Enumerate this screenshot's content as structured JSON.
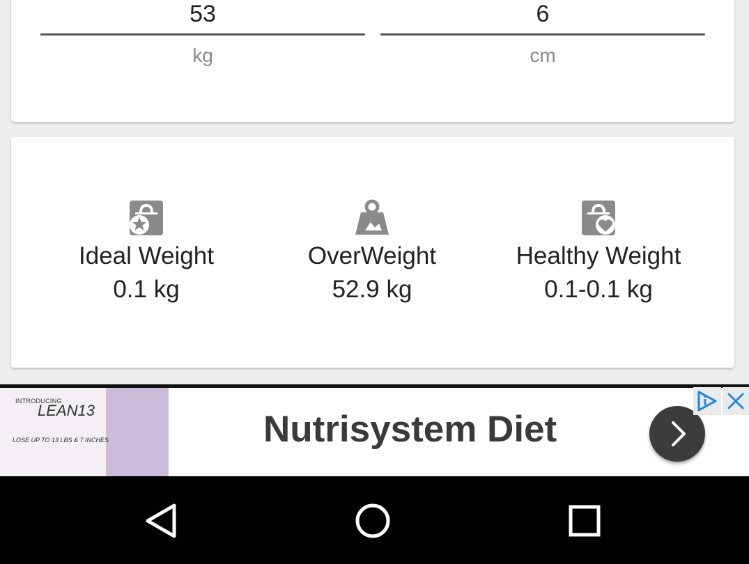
{
  "inputs": {
    "weight": {
      "value": "53",
      "unit": "kg"
    },
    "height": {
      "value": "6",
      "unit": "cm"
    }
  },
  "results": {
    "ideal": {
      "label": "Ideal Weight",
      "value": "0.1 kg",
      "icon": "scale-star-icon"
    },
    "over": {
      "label": "OverWeight",
      "value": "52.9 kg",
      "icon": "weight-icon"
    },
    "healthy": {
      "label": "Healthy Weight",
      "value": "0.1-0.1 kg",
      "icon": "scale-heart-icon"
    }
  },
  "ad": {
    "title": "Nutrisystem Diet",
    "image_intro": "INTRODUCING",
    "image_brand": "LEAN13",
    "image_tagline": "LOSE UP TO 13 LBS & 7 INCHES",
    "cta_icon": "chevron-right-icon",
    "adchoices_icon": "adchoices-icon",
    "close_icon": "close-icon"
  },
  "nav": {
    "back_icon": "back-triangle-icon",
    "home_icon": "home-circle-icon",
    "recents_icon": "recents-square-icon"
  },
  "colors": {
    "icon_gray": "#8a8a8a",
    "underline": "#555555",
    "unit_text": "#8a8a8a",
    "ad_accent": "#1e88e5",
    "nav_background": "#000000"
  }
}
